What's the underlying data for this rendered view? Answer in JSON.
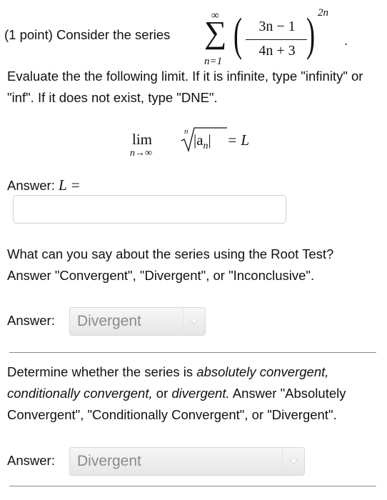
{
  "problem": {
    "intro": "(1 point) Consider the series",
    "series": {
      "upper_limit": "∞",
      "lower_limit": "n=1",
      "numerator": "3n − 1",
      "denominator": "4n + 3",
      "exponent": "2n"
    },
    "instruction": "Evaluate the the following limit. If it is infinite, type \"infinity\" or \"inf\". If it does not exist, type \"DNE\".",
    "limit": {
      "lim": "lim",
      "sub": "n→∞",
      "root_index": "n",
      "radicand": "|a",
      "radicand_sub": "n",
      "radicand_close": "|",
      "equals": "= L"
    }
  },
  "part1": {
    "answer_label": "Answer:",
    "answer_var": "L =",
    "input_value": ""
  },
  "part2": {
    "question": "What can you say about the series using the Root Test? Answer \"Convergent\", \"Divergent\", or \"Inconclusive\".",
    "answer_label": "Answer:",
    "selected": "Divergent",
    "arrow_icon": "chevron-down-icon"
  },
  "part3": {
    "question_a": "Determine whether the series is ",
    "question_b": "absolutely convergent, conditionally convergent,",
    "question_c": " or ",
    "question_d": "divergent.",
    "question_e": " Answer \"Absolutely Convergent\", \"Conditionally Convergent\", or \"Divergent\".",
    "answer_label": "Answer:",
    "selected": "Divergent",
    "arrow_icon": "chevron-down-icon"
  }
}
